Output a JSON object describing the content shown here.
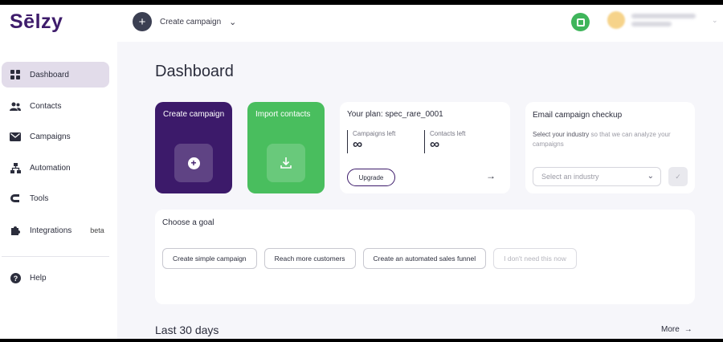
{
  "brand": {
    "logo_text": "Sēlzy",
    "accent": "#3c1a6a",
    "green": "#49be5e"
  },
  "topbar": {
    "create_label": "Create campaign",
    "create_icon": "plus-icon",
    "chevron_icon": "chevron-down-icon"
  },
  "sidebar": {
    "items": [
      {
        "label": "Dashboard",
        "icon": "grid-icon",
        "active": true
      },
      {
        "label": "Contacts",
        "icon": "users-icon"
      },
      {
        "label": "Campaigns",
        "icon": "mail-icon"
      },
      {
        "label": "Automation",
        "icon": "flow-icon"
      },
      {
        "label": "Tools",
        "icon": "magnet-icon"
      },
      {
        "label": "Integrations",
        "icon": "puzzle-icon",
        "badge": "beta"
      },
      {
        "label": "Help",
        "icon": "help-icon"
      }
    ]
  },
  "main": {
    "title": "Dashboard",
    "tiles": {
      "create": {
        "label": "Create campaign"
      },
      "import": {
        "label": "Import contacts"
      }
    },
    "plan": {
      "title": "Your plan: spec_rare_0001",
      "campaigns_label": "Campaigns left",
      "campaigns_value": "∞",
      "contacts_label": "Contacts left",
      "contacts_value": "∞",
      "upgrade_label": "Upgrade"
    },
    "checkup": {
      "title": "Email campaign checkup",
      "desc_strong": "Select your industry",
      "desc_rest": " so that we can analyze your campaigns",
      "select_placeholder": "Select an industry"
    },
    "goal": {
      "title": "Choose a goal",
      "options": [
        "Create simple campaign",
        "Reach more customers",
        "Create an automated sales funnel",
        "I don't need this now"
      ]
    },
    "last30": {
      "title": "Last 30 days",
      "more_label": "More"
    }
  }
}
